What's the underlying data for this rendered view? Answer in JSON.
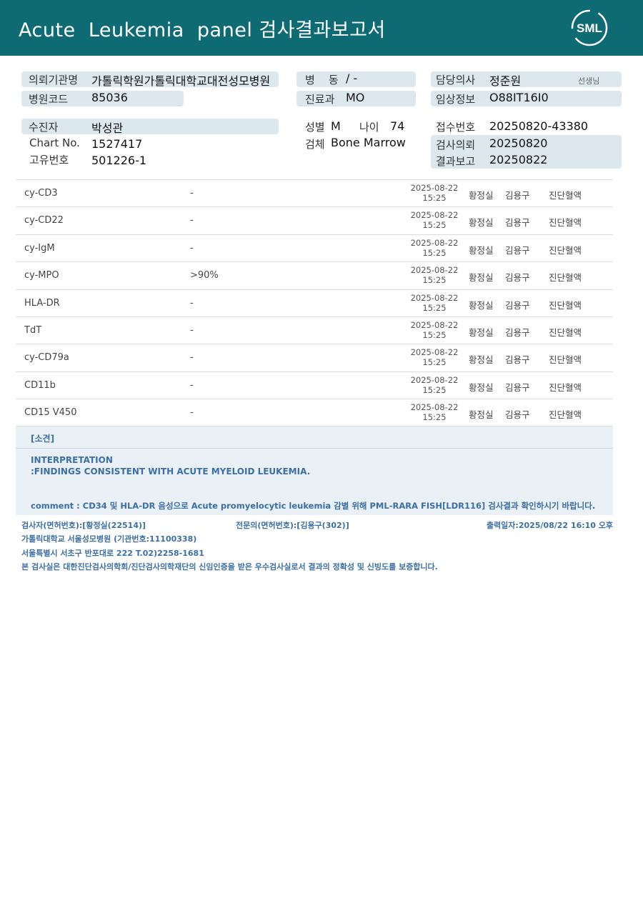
{
  "header": {
    "title": "Acute  Leukemia  panel 검사결과보고서",
    "logo_text": "SML"
  },
  "info": {
    "institution_label": "의뢰기관명",
    "institution_value": "가톨릭학원가톨릭대학교대전성모병원",
    "hospital_code_label": "병원코드",
    "hospital_code_value": "85036",
    "ward_label": "병    동",
    "ward_value": "/ -",
    "dept_label": "진료과",
    "dept_value": "MO",
    "doctor_label": "담당의사",
    "doctor_value": "정준원",
    "doctor_suffix": "선생님",
    "clinical_label": "임상정보",
    "clinical_value": "O88IT16I0",
    "patient_label": "수진자",
    "patient_value": "박성관",
    "chart_label": "Chart No.",
    "chart_value": "1527417",
    "unique_label": "고유번호",
    "unique_value": "501226-1",
    "sex_label": "성별",
    "sex_value": "M",
    "age_label": "나이",
    "age_value": "74",
    "specimen_label": "검체",
    "specimen_value": "Bone Marrow",
    "receipt_label": "접수번호",
    "receipt_value": "20250820-43380",
    "request_label": "검사의뢰",
    "request_value": "20250820",
    "report_label": "결과보고",
    "report_value": "20250822"
  },
  "results": [
    {
      "name": "cy-CD3",
      "result": "-",
      "date": "2025-08-22",
      "time": "15:25",
      "tech": "황정실",
      "doctor": "김용구",
      "category": "진단혈액"
    },
    {
      "name": "cy-CD22",
      "result": "-",
      "date": "2025-08-22",
      "time": "15:25",
      "tech": "황정실",
      "doctor": "김용구",
      "category": "진단혈액"
    },
    {
      "name": "cy-IgM",
      "result": "-",
      "date": "2025-08-22",
      "time": "15:25",
      "tech": "황정실",
      "doctor": "김용구",
      "category": "진단혈액"
    },
    {
      "name": "cy-MPO",
      "result": ">90%",
      "date": "2025-08-22",
      "time": "15:25",
      "tech": "황정실",
      "doctor": "김용구",
      "category": "진단혈액"
    },
    {
      "name": "HLA-DR",
      "result": "-",
      "date": "2025-08-22",
      "time": "15:25",
      "tech": "황정실",
      "doctor": "김용구",
      "category": "진단혈액"
    },
    {
      "name": "TdT",
      "result": "-",
      "date": "2025-08-22",
      "time": "15:25",
      "tech": "황정실",
      "doctor": "김용구",
      "category": "진단혈액"
    },
    {
      "name": "cy-CD79a",
      "result": "-",
      "date": "2025-08-22",
      "time": "15:25",
      "tech": "황정실",
      "doctor": "김용구",
      "category": "진단혈액"
    },
    {
      "name": "CD11b",
      "result": "-",
      "date": "2025-08-22",
      "time": "15:25",
      "tech": "황정실",
      "doctor": "김용구",
      "category": "진단혈액"
    },
    {
      "name": "CD15 V450",
      "result": "-",
      "date": "2025-08-22",
      "time": "15:25",
      "tech": "황정실",
      "doctor": "김용구",
      "category": "진단혈액"
    }
  ],
  "findings": {
    "label": "[소견]",
    "interpretation_title": "INTERPRETATION",
    "interpretation_text": ":FINDINGS CONSISTENT WITH ACUTE MYELOID LEUKEMIA.",
    "comment": "comment : CD34 및 HLA-DR 음성으로 Acute promyelocytic leukemia 감별 위해 PML-RARA FISH[LDR116] 검사결과 확인하시기 바랍니다."
  },
  "footer": {
    "tester": "검사자(면허번호):[황정실(22514)]",
    "specialist": "전문의(면허번호):[김용구(302)]",
    "printed": "출력일자:2025/08/22 16:10 오후",
    "hospital": "가톨릭대학교 서울성모병원 (기관번호:11100338)",
    "address": "서울특별시 서초구 반포대로 222 T.02)2258-1681",
    "certification": "본 검사실은 대한진단검사의학회/진단검사의학재단의 신임인증을 받은 우수검사실로서 결과의 정확성 및 신빙도를 보증합니다."
  },
  "colors": {
    "header_bg": "#0e6b73",
    "accent_blue": "#3c6fa6",
    "pill_bg": "#dce7ee"
  }
}
